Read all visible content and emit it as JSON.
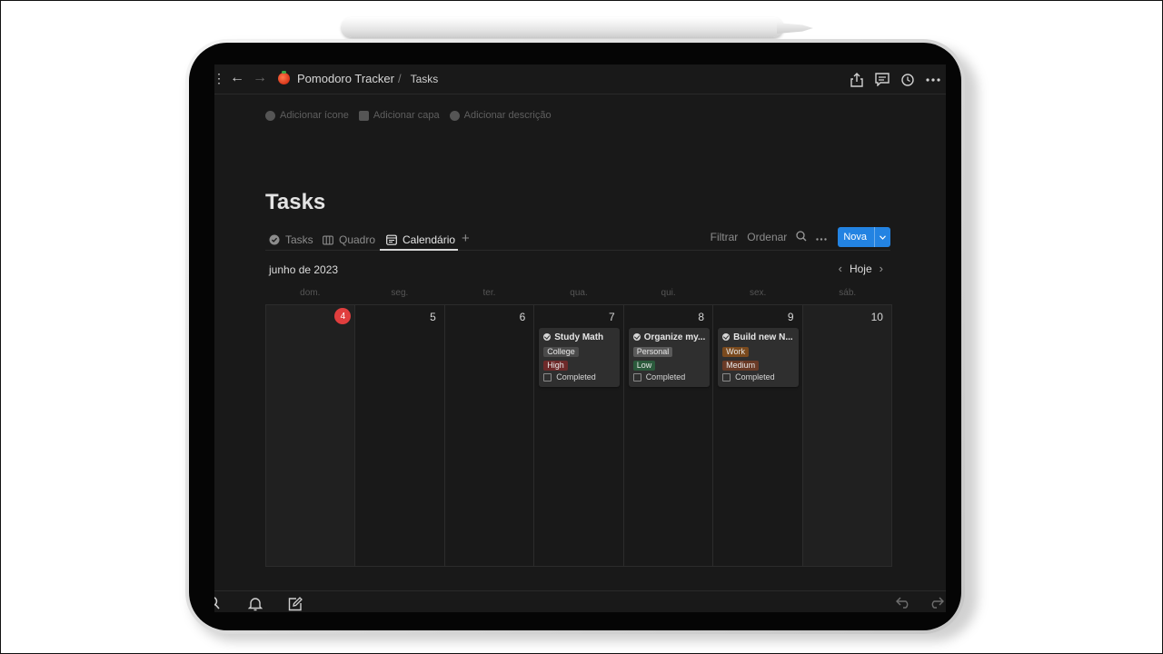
{
  "breadcrumb": {
    "workspace": "Pomodoro Tracker",
    "separator": "/",
    "current": "Tasks"
  },
  "topbar_icons": [
    "share-icon",
    "comment-icon",
    "history-icon",
    "more-icon"
  ],
  "page_actions": [
    {
      "label": "Adicionar ícone",
      "icon": "smiley-icon"
    },
    {
      "label": "Adicionar capa",
      "icon": "image-icon"
    },
    {
      "label": "Adicionar descrição",
      "icon": "info-icon"
    }
  ],
  "page_title": "Tasks",
  "views": [
    {
      "label": "Tasks",
      "icon": "check-circle-icon"
    },
    {
      "label": "Quadro",
      "icon": "board-icon"
    },
    {
      "label": "Calendário",
      "icon": "calendar-icon"
    }
  ],
  "active_view": "Calendário",
  "toolbar": {
    "filter": "Filtrar",
    "sort": "Ordenar",
    "new_button": "Nova"
  },
  "calendar": {
    "month": "junho de 2023",
    "today_label": "Hoje",
    "weekdays": [
      "dom.",
      "seg.",
      "ter.",
      "qua.",
      "qui.",
      "sex.",
      "sáb."
    ],
    "days": [
      "4",
      "5",
      "6",
      "7",
      "8",
      "9",
      "10"
    ],
    "today_day": "4"
  },
  "tasks": [
    {
      "title": "Study Math",
      "category": "College",
      "priority": "High",
      "checkbox_label": "Completed",
      "category_color": "#4a4a4a",
      "priority_color": "#6e2a2a"
    },
    {
      "title": "Organize my...",
      "category": "Personal",
      "priority": "Low",
      "checkbox_label": "Completed",
      "category_color": "#5a5a5a",
      "priority_color": "#2b5a3c"
    },
    {
      "title": "Build new N...",
      "category": "Work",
      "priority": "Medium",
      "checkbox_label": "Completed",
      "category_color": "#7a4a1e",
      "priority_color": "#6a3a26"
    }
  ],
  "colors": {
    "accent": "#2383e2",
    "today_badge": "#e03e3e",
    "background": "#191919"
  }
}
